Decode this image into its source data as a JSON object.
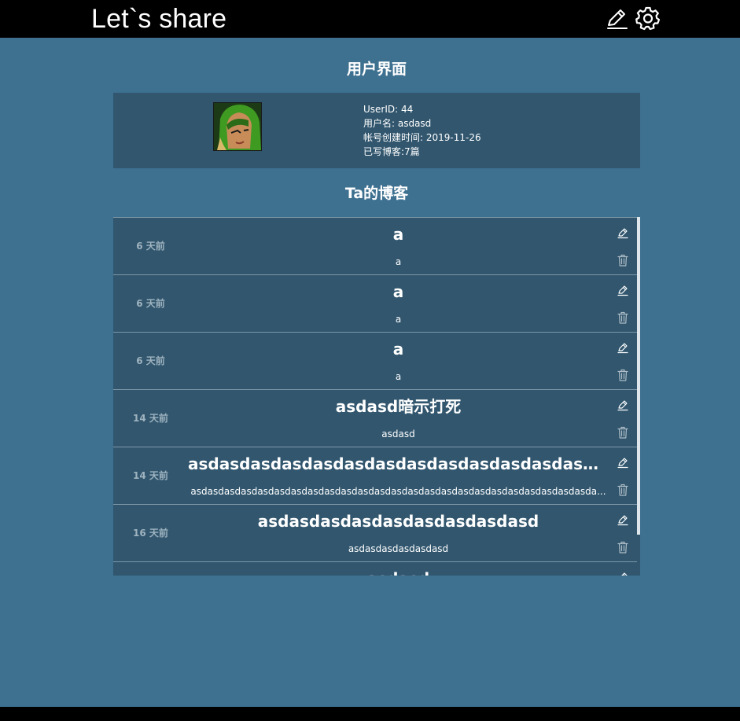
{
  "header": {
    "brand": "Let`s share",
    "icons": [
      "edit-icon",
      "settings-icon"
    ]
  },
  "user_section": {
    "title": "用户界面",
    "user_id": "UserID: 44",
    "username": "用户名: asdasd",
    "created": "帐号创建时间: 2019-11-26",
    "blog_count": "已写博客:7篇"
  },
  "blog_section": {
    "title": "Ta的博客",
    "items": [
      {
        "time": "6 天前",
        "title": "a",
        "summary": "a"
      },
      {
        "time": "6 天前",
        "title": "a",
        "summary": "a"
      },
      {
        "time": "6 天前",
        "title": "a",
        "summary": "a"
      },
      {
        "time": "14 天前",
        "title": "asdasd暗示打死",
        "summary": "asdasd"
      },
      {
        "time": "14 天前",
        "title": "asdasdasdasdasdasdasdasdasdasdasdasdasdasda...",
        "summary": "asdasdasdasdasdasdasdasdasdasdasdasdasdasdasdasdasdasdasdasdasdasdasdasda..."
      },
      {
        "time": "16 天前",
        "title": "asdasdasdasdasdasdasdasdasd",
        "summary": "asdasdasdasdasdasd"
      },
      {
        "time": "",
        "title": "asdasd",
        "summary": ""
      }
    ]
  },
  "colors": {
    "background": "#3e7090",
    "card": "#31566e",
    "topbar": "#000000",
    "divider": "#7d98a9",
    "muted_text": "#9fb3bf"
  }
}
